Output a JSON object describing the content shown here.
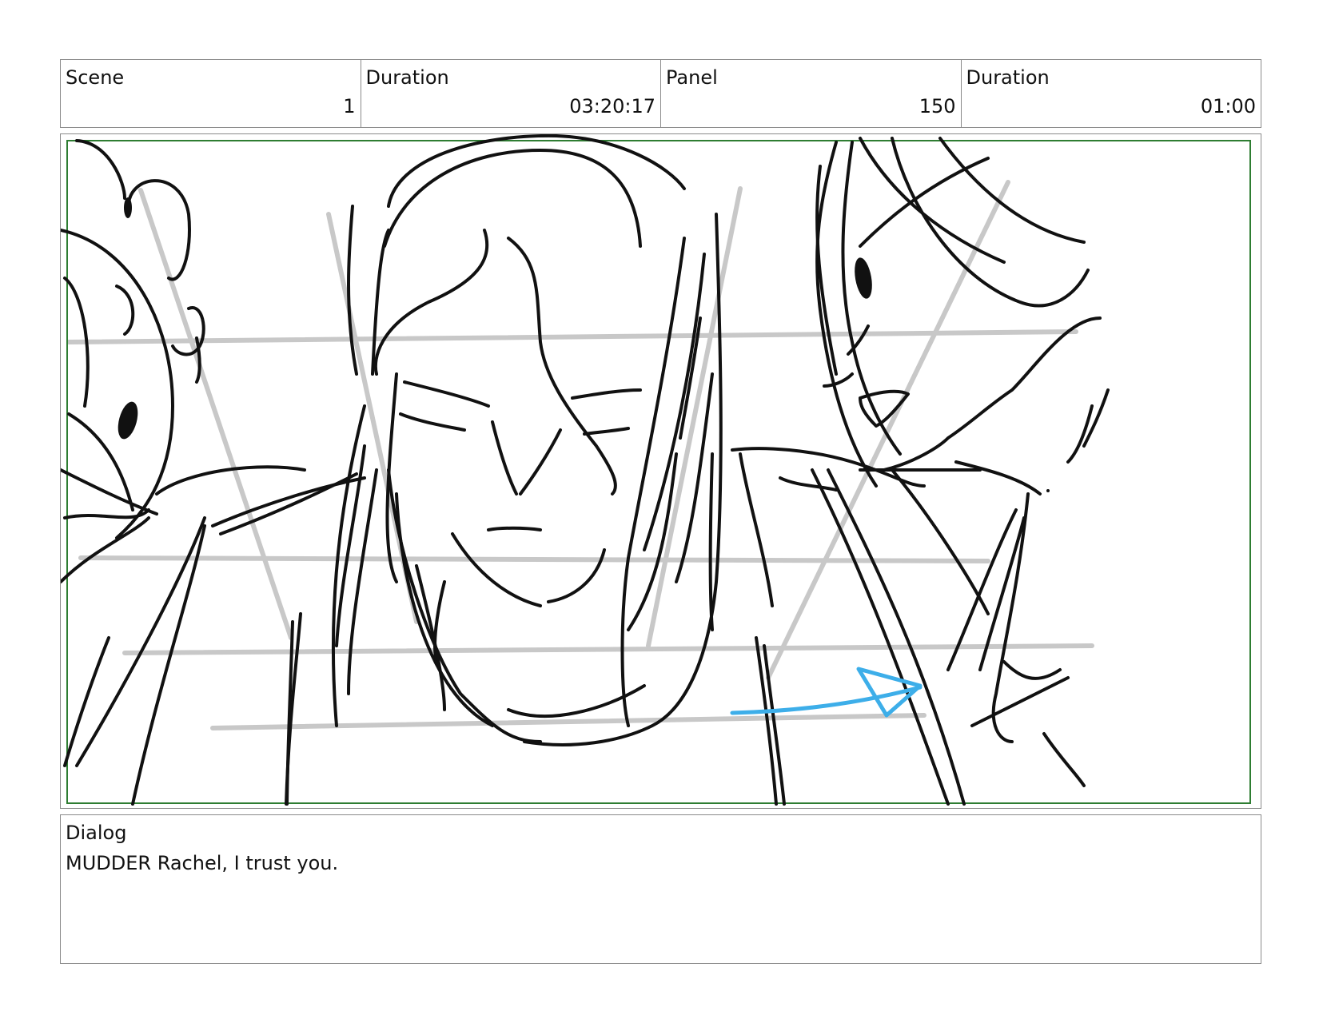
{
  "header": {
    "scene_label": "Scene",
    "scene_value": "1",
    "scene_duration_label": "Duration",
    "scene_duration_value": "03:20:17",
    "panel_label": "Panel",
    "panel_value": "150",
    "panel_duration_label": "Duration",
    "panel_duration_value": "01:00"
  },
  "panel": {
    "sketch_stroke_color": "#111111",
    "guide_line_color": "#c8c8c8",
    "safe_frame_color": "#2e7d32",
    "camera_arrow_color": "#3daee9"
  },
  "dialog": {
    "label": "Dialog",
    "text": "MUDDER Rachel, I trust you."
  }
}
